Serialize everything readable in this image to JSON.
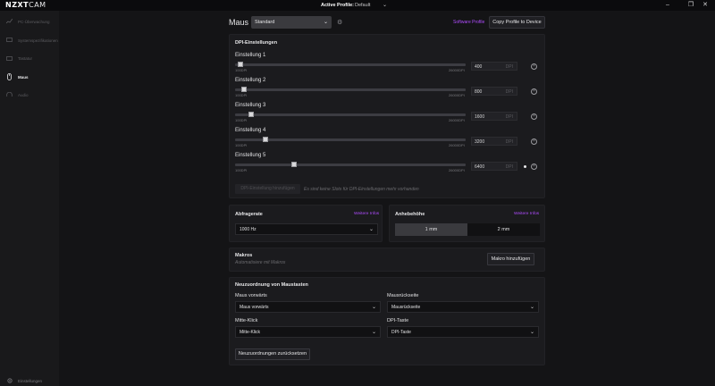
{
  "app": {
    "logo_main": "NZXT",
    "logo_suffix": "CAM",
    "active_profile_label": "Active Profile:",
    "active_profile_value": "Default"
  },
  "sidebar": {
    "items": [
      {
        "label": "PC-Überwachung",
        "icon": "line-chart-icon"
      },
      {
        "label": "Systemspezifikationen",
        "icon": "monitor-icon"
      },
      {
        "label": "Tastatur",
        "icon": "keyboard-icon"
      },
      {
        "label": "Maus",
        "icon": "mouse-icon"
      },
      {
        "label": "Audio",
        "icon": "headphones-icon"
      }
    ],
    "settings_label": "Einstellungen"
  },
  "header": {
    "title": "Maus",
    "profile_value": "Standard",
    "software_profile": "Software Profile",
    "copy_button": "Copy Profile to Device"
  },
  "dpi": {
    "title": "DPI-Einstellungen",
    "min_label": "100DPI",
    "max_label": "26000DPI",
    "unit": "DPI",
    "rows": [
      {
        "label": "Einstellung 1",
        "value": "400",
        "level": 0.012
      },
      {
        "label": "Einstellung 2",
        "value": "800",
        "level": 0.027
      },
      {
        "label": "Einstellung 3",
        "value": "1600",
        "level": 0.058
      },
      {
        "label": "Einstellung 4",
        "value": "3200",
        "level": 0.12
      },
      {
        "label": "Einstellung 5",
        "value": "6400",
        "level": 0.243
      }
    ],
    "add_button": "DPI-Einstellung hinzufügen",
    "no_slots_text": "Es sind keine Slots für DPI-Einstellungen mehr vorhanden"
  },
  "polling": {
    "title": "Abfragerate",
    "more_info": "Weitere Infos",
    "value": "1000 Hz"
  },
  "lift": {
    "title": "Anhebehöhe",
    "more_info": "Weitere Infos",
    "options": [
      "1 mm",
      "2 mm"
    ],
    "selected": "1 mm"
  },
  "macros": {
    "title": "Makros",
    "subtitle": "Automatisiere mit Makros",
    "add_button": "Makro hinzufügen"
  },
  "remap": {
    "title": "Neuzuordnung von Maustasten",
    "fields": [
      {
        "label": "Maus vorwärts",
        "value": "Maus vorwärts"
      },
      {
        "label": "Mausrückseite",
        "value": "Mausrückseite"
      },
      {
        "label": "Mitte-Klick",
        "value": "Mitte-Klick"
      },
      {
        "label": "DPI-Taste",
        "value": "DPI-Taste"
      }
    ],
    "reset_button": "Neuzuordnungen zurücksetzen"
  },
  "colors": {
    "accent": "#b04dff",
    "background": "#141416",
    "panel": "#1b1b1e",
    "sidebar": "#19191b"
  }
}
